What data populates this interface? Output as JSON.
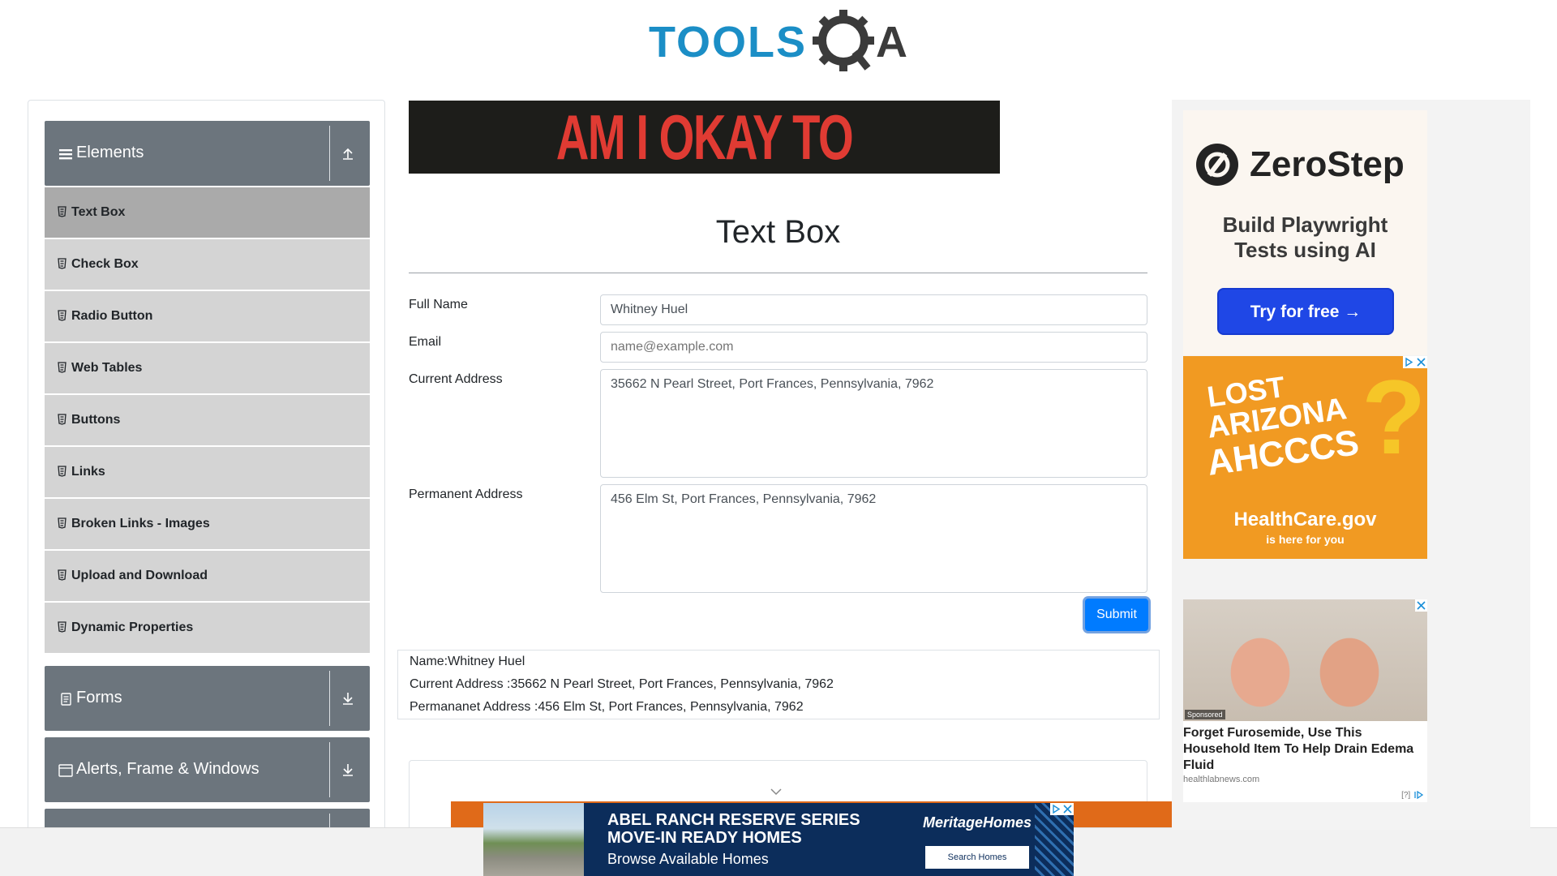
{
  "header": {
    "logo_text": "TOOLSQA"
  },
  "sidebar": {
    "elements": {
      "title": "Elements",
      "items": [
        {
          "label": "Text Box",
          "active": true
        },
        {
          "label": "Check Box"
        },
        {
          "label": "Radio Button"
        },
        {
          "label": "Web Tables"
        },
        {
          "label": "Buttons"
        },
        {
          "label": "Links"
        },
        {
          "label": "Broken Links - Images"
        },
        {
          "label": "Upload and Download"
        },
        {
          "label": "Dynamic Properties"
        }
      ]
    },
    "forms": {
      "title": "Forms"
    },
    "alerts": {
      "title": "Alerts, Frame & Windows"
    }
  },
  "top_banner": {
    "text": "AM I OKAY TO DRIVE?"
  },
  "main": {
    "title": "Text Box",
    "form": {
      "full_name_label": "Full Name",
      "full_name_value": "Whitney Huel",
      "email_label": "Email",
      "email_placeholder": "name@example.com",
      "current_address_label": "Current Address",
      "current_address_value": "35662 N Pearl Street, Port Frances, Pennsylvania, 7962",
      "permanent_address_label": "Permanent Address",
      "permanent_address_value": "456 Elm St, Port Frances, Pennsylvania, 7962",
      "submit_label": "Submit"
    },
    "output": {
      "name": "Name:Whitney Huel",
      "current_address": "Current Address :35662 N Pearl Street, Port Frances, Pennsylvania, 7962",
      "permanent_address": "Permananet Address :456 Elm St, Port Frances, Pennsylvania, 7962"
    }
  },
  "ads": {
    "zerostep": {
      "name": "ZeroStep",
      "tagline_line1": "Build Playwright",
      "tagline_line2": "Tests using AI",
      "cta": "Try for free →"
    },
    "arizona": {
      "line1": "LOST",
      "line2": "ARIZONA",
      "line3": "AHCCCS",
      "brand": "HealthCare.gov",
      "brand_sub": "is here for you"
    },
    "edema": {
      "sponsored": "Sponsored",
      "headline": "Forget Furosemide, Use This Household Item To Help Drain Edema Fluid",
      "source": "healthlabnews.com",
      "marker": "[?]"
    },
    "bottom": {
      "line1": "ABEL RANCH RESERVE SERIES",
      "line2": "MOVE-IN READY HOMES",
      "line3": "Browse Available Homes",
      "brand": "MeritageHomes",
      "cta": "Search Homes"
    }
  },
  "colors": {
    "sidebar_header": "#6c757d",
    "menu_item": "#d4d4d4",
    "menu_item_active": "#aaaaaa",
    "primary_button": "#007bff",
    "logo_blue": "#1b8ec6",
    "logo_dark": "#333333"
  },
  "icons": {
    "elements_group": "menu-icon",
    "elements_toggle": "collapse-up-icon",
    "forms_toggle": "expand-down-icon",
    "menu_item": "document-icon"
  }
}
